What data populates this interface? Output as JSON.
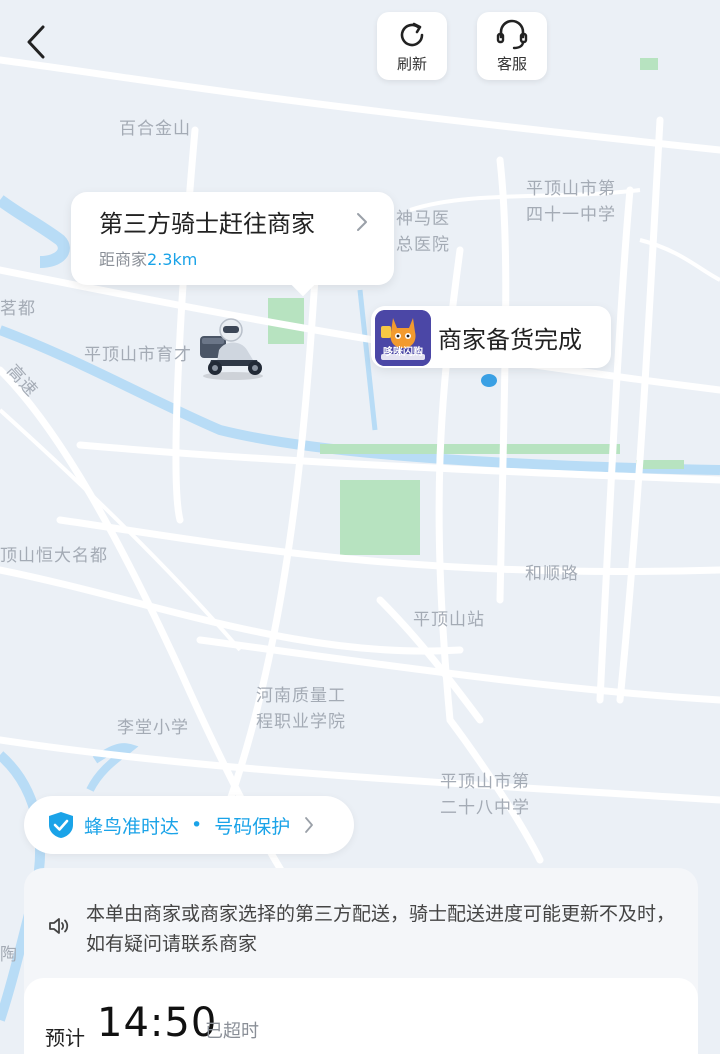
{
  "header": {
    "refresh_label": "刷新",
    "service_label": "客服"
  },
  "map": {
    "labels": [
      "百合金山",
      "平顶山市第",
      "四十一中学",
      "神马医",
      "总医院",
      "茗都",
      "平顶山市育才",
      "高速",
      "顶山恒大名都",
      "和顺路",
      "平顶山站",
      "河南质量工",
      "程职业学院",
      "李堂小学",
      "平顶山市第",
      "二十八中学",
      "陶"
    ],
    "colors": {
      "road": "#ffffff",
      "water": "#b8dcf6",
      "park": "#b7e3c0",
      "background": "#ebf0f6"
    }
  },
  "rider": {
    "status": "第三方骑士赶往商家",
    "distance_prefix": "距商家",
    "distance": "2.3km"
  },
  "merchant": {
    "logo_text": "哆咪闪购",
    "status": "商家备货完成"
  },
  "guarantee": {
    "on_time": "蜂鸟准时达",
    "separator": "•",
    "number_protection": "号码保护"
  },
  "notice": {
    "text": "本单由商家或商家选择的第三方配送，骑士配送进度可能更新不及时，如有疑问请联系商家"
  },
  "eta": {
    "prefix": "预计",
    "time": "14:50",
    "status": "已超时"
  },
  "accent_color": "#1aa3e8"
}
